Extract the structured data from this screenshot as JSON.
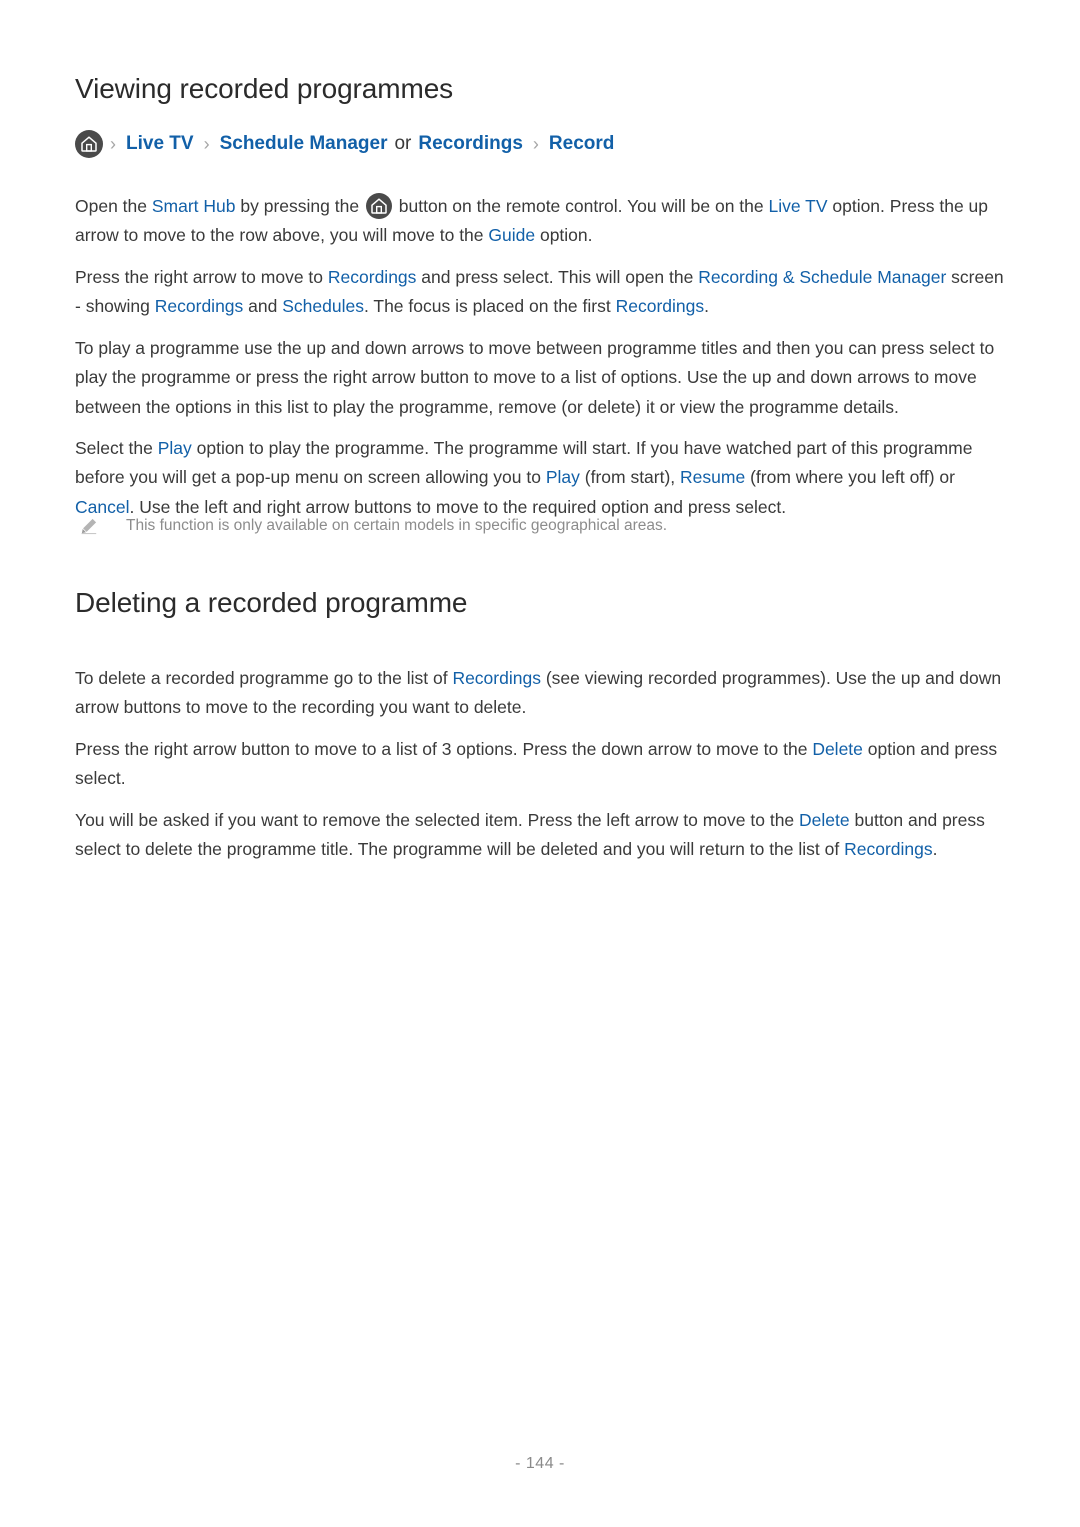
{
  "page": {
    "footer_label": "- 144 -",
    "link_color": "#1260a8",
    "body_color": "#3a3a3a",
    "note_color": "#8c8c8c"
  },
  "section1": {
    "title": "Viewing recorded programmes",
    "breadcrumb": {
      "home_icon": "home-icon",
      "items": [
        {
          "label": "Live TV",
          "type": "link"
        },
        {
          "label": "Schedule Manager",
          "type": "link"
        },
        {
          "label": "or",
          "type": "plain"
        },
        {
          "label": "Recordings",
          "type": "link"
        },
        {
          "label": "Record",
          "type": "link"
        }
      ],
      "separator": "›"
    },
    "paragraphs": {
      "p1": {
        "a": "Open the ",
        "link1": "Smart Hub",
        "b": " by pressing the ",
        "icon": "home-icon",
        "c": " button on the remote control. You will be on the ",
        "link2": "Live TV",
        "d": " option. Press the up arrow to move to the row above, you will move to the ",
        "link3": "Guide",
        "e": " option."
      },
      "p2": {
        "a": "Press the right arrow to move to ",
        "link1": "Recordings",
        "b": " and press select. This will open the ",
        "link2": "Recording & Schedule Manager",
        "c": " screen - showing ",
        "link3": "Recordings",
        "d": " and ",
        "link4": "Schedules",
        "e": ". The focus is placed on the first ",
        "link5": "Recordings",
        "f": "."
      },
      "p3": {
        "text": "To play a programme use the up and down arrows to move between programme titles and then you can press select to play the programme or press the right arrow button to move to a list of options. Use the up and down arrows to move between the options in this list to play the programme, remove (or delete) it or view the programme details."
      },
      "p4": {
        "a": "Select the ",
        "link1": "Play",
        "b": " option to play the programme. The programme will start. If you have watched part of this programme before you will get a pop-up menu on screen allowing you to ",
        "link2": "Play",
        "c": " (from start), ",
        "link3": "Resume",
        "d": " (from where you left off) or ",
        "link4": "Cancel",
        "e": ". Use the left and right arrow buttons to move to the required option and press select."
      }
    },
    "note": {
      "icon": "pencil-icon",
      "text": "This function is only available on certain models in specific geographical areas."
    }
  },
  "section2": {
    "title": "Deleting a recorded programme",
    "paragraphs": {
      "p1": {
        "a": "To delete a recorded programme go to the list of ",
        "link1": "Recordings",
        "b": " (see viewing recorded programmes). Use the up and down arrow buttons to move to the recording you want to delete."
      },
      "p2": {
        "a": "Press the right arrow button to move to a list of 3 options. Press the down arrow to move to the ",
        "link1": "Delete",
        "b": " option and press select."
      },
      "p3": {
        "a": "You will be asked if you want to remove the selected item. Press the left arrow to move to the ",
        "link1": "Delete",
        "b": " button and press select to delete the programme title. The programme will be deleted and you will return to the list of ",
        "link2": "Recordings",
        "c": "."
      }
    }
  }
}
